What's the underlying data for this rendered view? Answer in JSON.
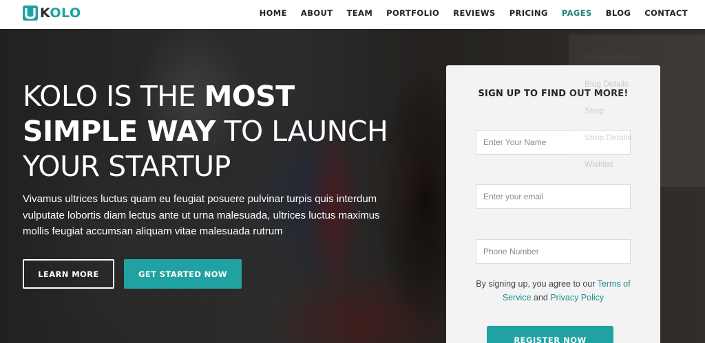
{
  "brand": {
    "name_first": "K",
    "name_rest": "OLO",
    "accent": "#1fa2a1"
  },
  "nav": {
    "items": [
      "HOME",
      "ABOUT",
      "TEAM",
      "PORTFOLIO",
      "REVIEWS",
      "PRICING",
      "PAGES",
      "BLOG",
      "CONTACT"
    ],
    "active": "PAGES"
  },
  "pages_dropdown": [
    "Standard Page",
    "Blog Details",
    "Shop",
    "Shop Details",
    "Wishlist"
  ],
  "hero": {
    "headline_1": "KOLO IS THE ",
    "headline_1_bold": "MOST",
    "headline_2_bold": "SIMPLE WAY",
    "headline_2": " TO LAUNCH",
    "headline_3": "YOUR STARTUP",
    "description": "Vivamus ultrices luctus quam eu feugiat posuere pulvinar turpis quis interdum vulputate lobortis diam lectus ante ut urna malesuada, ultrices luctus maximus mollis feugiat accumsan aliquam vitae malesuada rutrum",
    "learn_more": "LEARN MORE",
    "get_started": "GET STARTED NOW"
  },
  "signup": {
    "title": "SIGN UP TO FIND OUT MORE!",
    "name_placeholder": "Enter Your Name",
    "email_placeholder": "Enter your email",
    "phone_placeholder": "Phone Number",
    "terms_prefix": "By signing up, you agree to our ",
    "terms_link": "Terms of Service",
    "terms_and": " and ",
    "privacy_link": "Privacy Policy",
    "register": "REGISTER NOW"
  }
}
